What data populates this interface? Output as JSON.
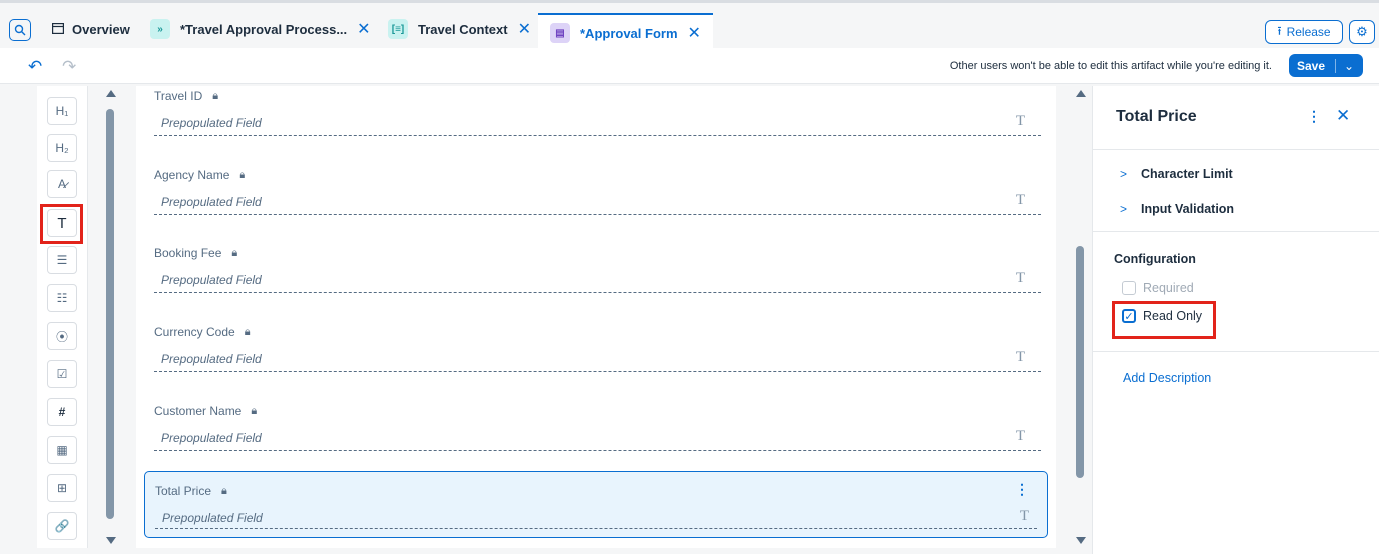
{
  "tabs": [
    {
      "label": "Overview",
      "icon": "overview-icon"
    },
    {
      "label": "*Travel Approval Process...",
      "icon": "process-icon"
    },
    {
      "label": "Travel Context",
      "icon": "context-icon"
    },
    {
      "label": "*Approval Form",
      "icon": "form-icon",
      "active": true
    }
  ],
  "header": {
    "release_label": "Release"
  },
  "toolbar": {
    "lock_message": "Other users won't be able to edit this artifact while you're editing it.",
    "save_label": "Save"
  },
  "palette": {
    "items": [
      "H₁",
      "H₂",
      "A̷",
      "T",
      "☰",
      "☷",
      "⦿",
      "☑",
      "#",
      "▦",
      "⊞",
      "🔗"
    ]
  },
  "form": {
    "fields": [
      {
        "label": "Travel ID",
        "value": "Prepopulated Field"
      },
      {
        "label": "Agency Name",
        "value": "Prepopulated Field"
      },
      {
        "label": "Booking Fee",
        "value": "Prepopulated Field"
      },
      {
        "label": "Currency Code",
        "value": "Prepopulated Field"
      },
      {
        "label": "Customer Name",
        "value": "Prepopulated Field"
      },
      {
        "label": "Total Price",
        "value": "Prepopulated Field",
        "selected": true
      }
    ],
    "type_glyph": "T"
  },
  "panel": {
    "title": "Total Price",
    "sections": [
      "Character Limit",
      "Input Validation"
    ],
    "config_title": "Configuration",
    "required_label": "Required",
    "readonly_label": "Read Only",
    "add_description": "Add Description"
  },
  "colors": {
    "accent": "#0a6ed1",
    "highlight": "#e2231a",
    "selected_bg": "#e8f4fd"
  }
}
